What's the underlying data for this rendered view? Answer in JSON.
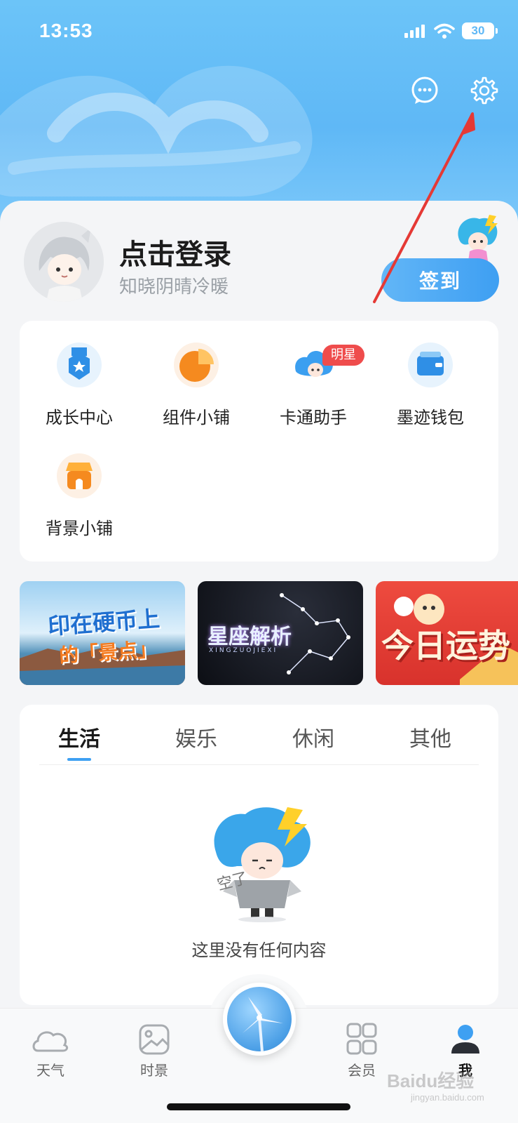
{
  "status": {
    "time": "13:53",
    "battery": "30"
  },
  "colors": {
    "accent": "#3ea0f2",
    "badge": "#ef4c4c",
    "arrow": "#e53935"
  },
  "header_actions": [
    {
      "name": "message-icon"
    },
    {
      "name": "gear-icon"
    }
  ],
  "profile": {
    "login_label": "点击登录",
    "slogan": "知晓阴晴冷暖",
    "checkin_label": "签到"
  },
  "features": {
    "items": [
      {
        "label": "成长中心",
        "icon": "medal-icon"
      },
      {
        "label": "组件小铺",
        "icon": "pie-chart-icon"
      },
      {
        "label": "卡通助手",
        "icon": "cartoon-cloud-icon",
        "badge": "明星"
      },
      {
        "label": "墨迹钱包",
        "icon": "wallet-icon"
      },
      {
        "label": "背景小铺",
        "icon": "shop-icon"
      }
    ]
  },
  "banners": [
    {
      "line1": "印在硬币上",
      "line2": "的「景点」"
    },
    {
      "title": "星座解析",
      "subtitle": "XINGZUOJIEXI"
    },
    {
      "title": "今日运势"
    }
  ],
  "content_tabs": {
    "tabs": [
      "生活",
      "娱乐",
      "休闲",
      "其他"
    ],
    "active": 0,
    "empty_mark": "空了",
    "empty_text": "这里没有任何内容"
  },
  "bottom_nav": {
    "items": [
      {
        "label": "天气",
        "icon": "cloud-icon"
      },
      {
        "label": "时景",
        "icon": "image-icon"
      },
      {
        "label": "会员",
        "icon": "grid-icon"
      },
      {
        "label": "我",
        "icon": "user-icon",
        "active": true
      }
    ]
  },
  "watermark": {
    "brand": "Baidu经验",
    "url": "jingyan.baidu.com"
  }
}
